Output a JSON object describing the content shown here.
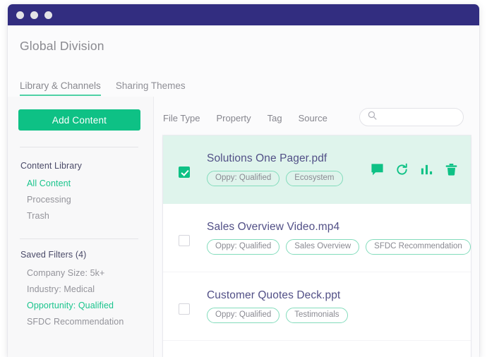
{
  "window": {
    "titlebar_color": "#322d80",
    "traffic_lights": [
      "close",
      "minimize",
      "maximize"
    ]
  },
  "header": {
    "title": "Global Division"
  },
  "tabs": [
    {
      "label": "Library & Channels",
      "active": true
    },
    {
      "label": "Sharing Themes",
      "active": false
    }
  ],
  "sidebar": {
    "add_content_label": "Add Content",
    "sections": [
      {
        "heading": "Content Library",
        "items": [
          {
            "label": "All Content",
            "active": true
          },
          {
            "label": "Processing",
            "active": false
          },
          {
            "label": "Trash",
            "active": false
          }
        ]
      },
      {
        "heading": "Saved Filters (4)",
        "items": [
          {
            "label": "Company Size: 5k+",
            "active": false
          },
          {
            "label": "Industry: Medical",
            "active": false
          },
          {
            "label": "Opportunity: Qualified",
            "active": true
          },
          {
            "label": "SFDC Recommendation",
            "active": false
          }
        ]
      }
    ]
  },
  "main": {
    "filters": [
      "File Type",
      "Property",
      "Tag",
      "Source"
    ],
    "search": {
      "value": "",
      "placeholder": ""
    },
    "rows": [
      {
        "name": "Solutions One Pager.pdf",
        "selected": true,
        "checked": true,
        "tags": [
          "Oppy: Qualified",
          "Ecosystem"
        ],
        "actions": [
          "comment-icon",
          "refresh-icon",
          "analytics-icon",
          "trash-icon"
        ]
      },
      {
        "name": "Sales Overview Video.mp4",
        "selected": false,
        "checked": false,
        "tags": [
          "Oppy: Qualified",
          "Sales Overview",
          "SFDC Recommendation"
        ],
        "actions": []
      },
      {
        "name": "Customer Quotes Deck.ppt",
        "selected": false,
        "checked": false,
        "tags": [
          "Oppy: Qualified",
          "Testimonials"
        ],
        "actions": []
      }
    ]
  },
  "colors": {
    "accent_green": "#0ec185",
    "tab_underline": "#4fd1a5",
    "selected_row": "#dff4ec",
    "title_bar": "#322d80",
    "file_name": "#514f86"
  }
}
